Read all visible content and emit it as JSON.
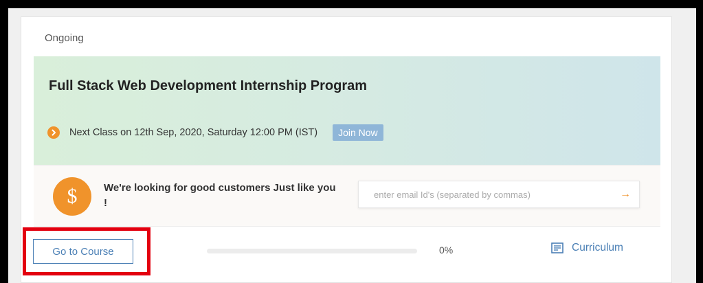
{
  "card": {
    "status": "Ongoing",
    "title": "Full Stack Web Development Internship Program",
    "next_class": "Next Class on 12th Sep, 2020, Saturday 12:00 PM (IST)",
    "join_label": "Join Now"
  },
  "referral": {
    "text": "We're looking for good customers Just like you !",
    "icon": "dollar-icon",
    "dollar_symbol": "$",
    "email_placeholder": "enter email Id's (separated by commas)",
    "email_value": "",
    "submit_arrow": "→"
  },
  "footer": {
    "go_to_course_label": "Go to Course",
    "progress_fraction": 0,
    "progress_label": "0%",
    "curriculum_label": "Curriculum"
  },
  "colors": {
    "accent_orange": "#f0932b",
    "link_blue": "#4a7fb5",
    "highlight_red": "#e3000f",
    "join_button_bg": "#8fb6d8"
  }
}
